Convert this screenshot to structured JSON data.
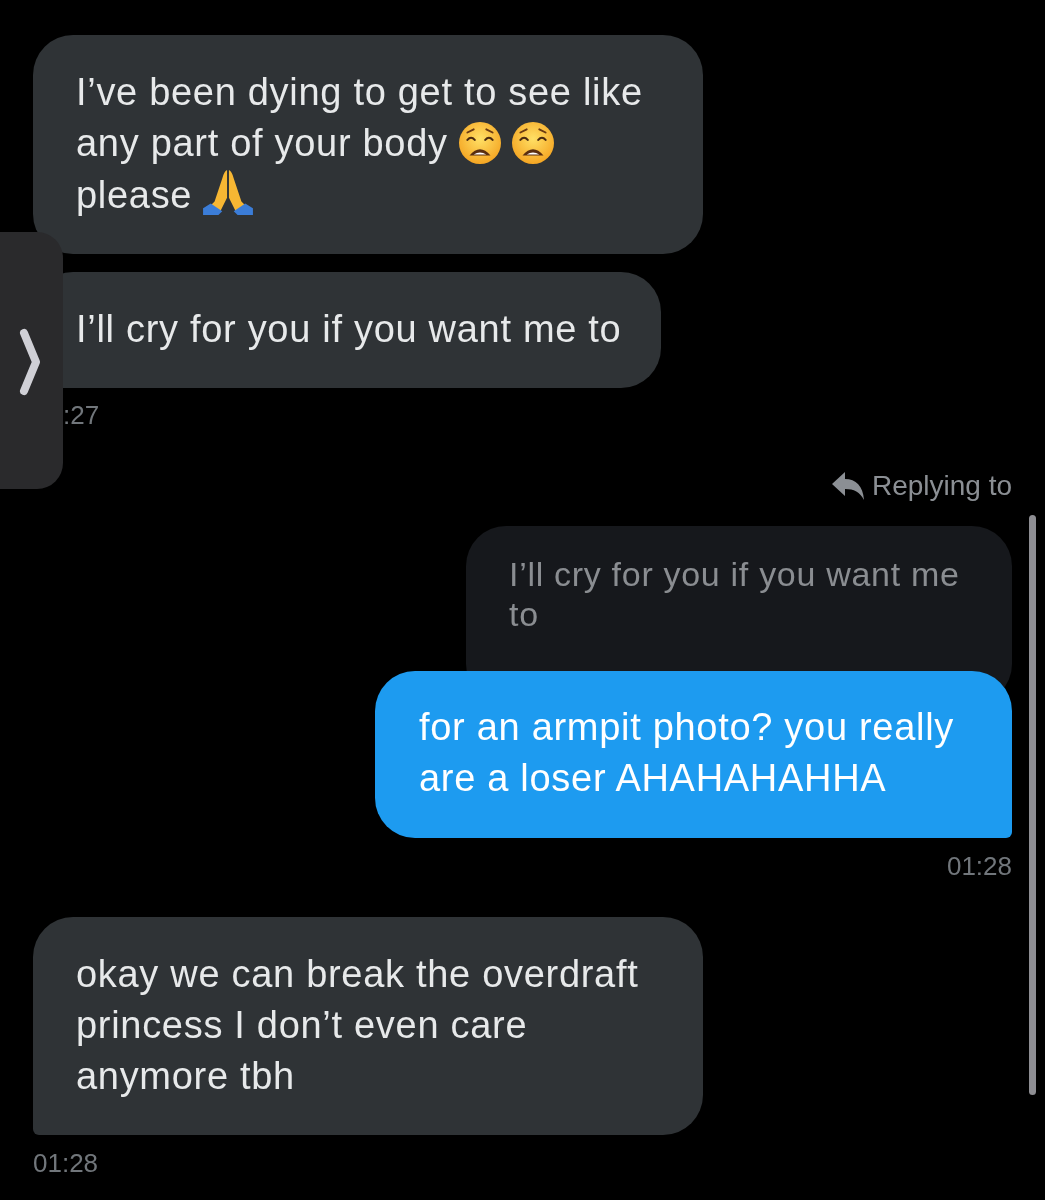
{
  "messages": [
    {
      "kind": "received",
      "parts": [
        {
          "kind": "text",
          "text": "I’ve been dying to get to see like"
        },
        {
          "kind": "text",
          "text": "any part of your body"
        },
        {
          "kind": "weary_face"
        },
        {
          "kind": "weary_face"
        },
        {
          "kind": "text",
          "text": "please"
        },
        {
          "kind": "folded_hands"
        }
      ]
    },
    {
      "kind": "received",
      "parts": [
        {
          "kind": "text",
          "text": "I’ll cry for you if you want me to"
        }
      ],
      "time": ":27"
    },
    {
      "kind": "sent",
      "reply_label": "Replying to",
      "quote": "I’ll cry for you if you want me to",
      "parts": [
        {
          "kind": "text",
          "text": "for an armpit photo? you really are a loser AHAHAHAHHA"
        }
      ],
      "time": "01:28"
    },
    {
      "kind": "received",
      "parts": [
        {
          "kind": "text",
          "text": "okay we can break the overdraft princess I don’t even care anymore tbh"
        }
      ],
      "time": "01:28"
    }
  ]
}
